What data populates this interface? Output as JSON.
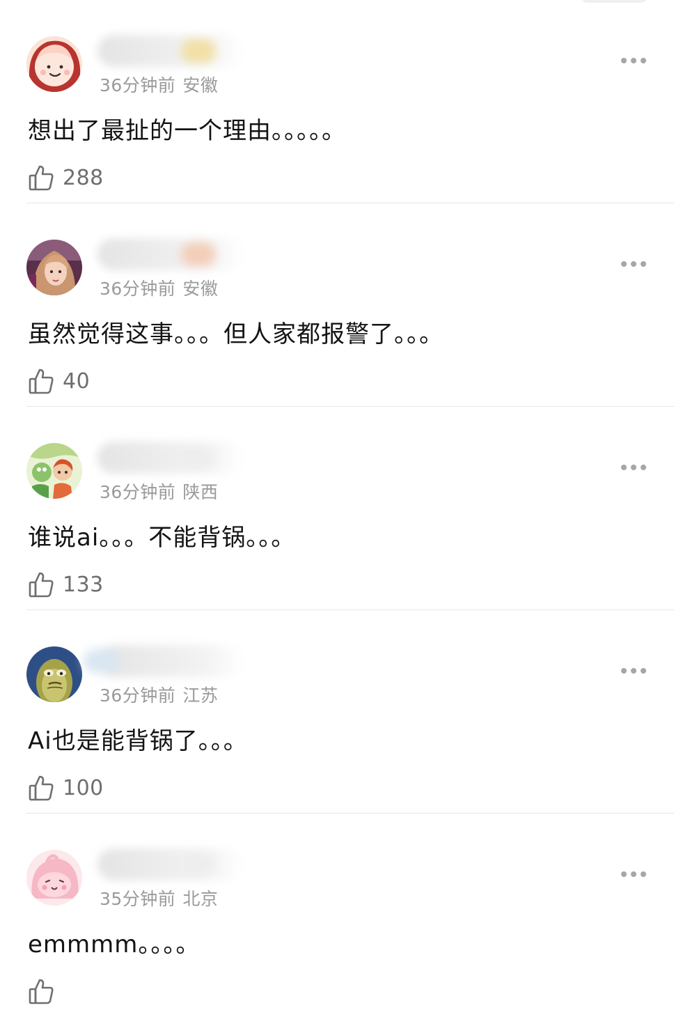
{
  "comments": [
    {
      "time": "36分钟前",
      "location": "安徽",
      "text": "想出了最扯的一个理由。。。。。",
      "likes": "288",
      "avatar_icon": "cartoon-baby-face-icon",
      "name_tint": "#f1dfa4"
    },
    {
      "time": "36分钟前",
      "location": "安徽",
      "text": "虽然觉得这事。。。但人家都报警了。。。",
      "likes": "40",
      "avatar_icon": "girl-photo-avatar-icon",
      "name_tint": "#f3cdb8"
    },
    {
      "time": "36分钟前",
      "location": "陕西",
      "text": "谁说ai。。。不能背锅。。。",
      "likes": "133",
      "avatar_icon": "cartoon-kids-avatar-icon",
      "name_tint": "#eeeeee"
    },
    {
      "time": "36分钟前",
      "location": "江苏",
      "text": "Ai也是能背锅了。。。",
      "likes": "100",
      "avatar_icon": "cartoon-fish-avatar-icon",
      "name_tint": "#d8e6f1"
    },
    {
      "time": "35分钟前",
      "location": "北京",
      "text": "emmmm。。。。",
      "likes": "",
      "avatar_icon": "pink-blob-avatar-icon",
      "name_tint": "#eeeeee"
    }
  ],
  "colors": {
    "meta_text": "#9a9a9a",
    "body_text": "#141414",
    "icon_gray": "#6e6e6e"
  }
}
